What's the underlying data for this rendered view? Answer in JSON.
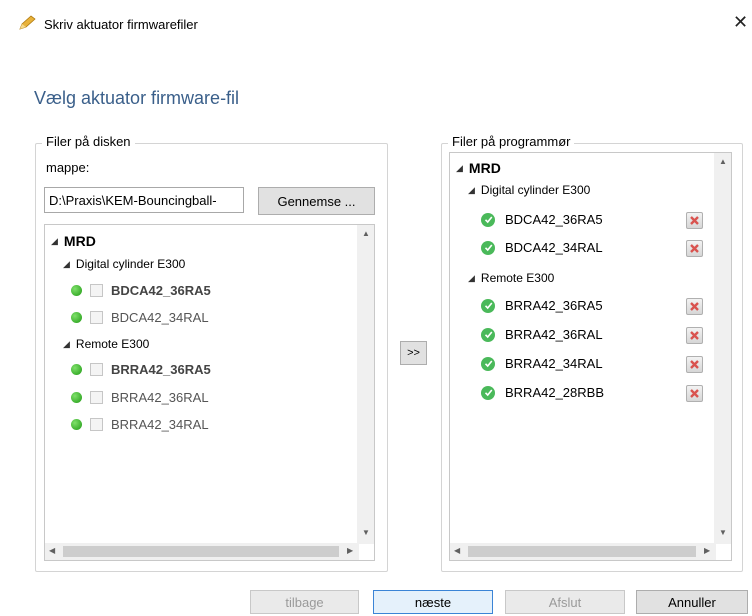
{
  "window": {
    "title": "Skriv aktuator firmwarefiler",
    "app_icon": "pencil-icon",
    "close_icon": "close-icon"
  },
  "heading": "Vælg aktuator firmware-fil",
  "disk_panel": {
    "title": "Filer på disken",
    "folder_label": "mappe:",
    "path_value": "D:\\Praxis\\KEM-Bouncingball-",
    "browse_label": "Gennemse ...",
    "tree": {
      "root": "MRD",
      "groups": [
        {
          "label": "Digital cylinder E300",
          "items": [
            {
              "label": "BDCA42_36RA5",
              "bold": true
            },
            {
              "label": "BDCA42_34RAL",
              "bold": false
            }
          ]
        },
        {
          "label": "Remote E300",
          "items": [
            {
              "label": "BRRA42_36RA5",
              "bold": true
            },
            {
              "label": "BRRA42_36RAL",
              "bold": false
            },
            {
              "label": "BRRA42_34RAL",
              "bold": false
            }
          ]
        }
      ]
    }
  },
  "transfer_label": ">>",
  "programmer_panel": {
    "title": "Filer på programmør",
    "tree": {
      "root": "MRD",
      "groups": [
        {
          "label": "Digital cylinder E300",
          "items": [
            "BDCA42_36RA5",
            "BDCA42_34RAL"
          ]
        },
        {
          "label": "Remote E300",
          "items": [
            "BRRA42_36RA5",
            "BRRA42_36RAL",
            "BRRA42_34RAL",
            "BRRA42_28RBB"
          ]
        }
      ]
    }
  },
  "footer": {
    "back": "tilbage",
    "next": "næste",
    "finish": "Afslut",
    "cancel": "Annuller"
  },
  "colors": {
    "heading": "#3a5f8a",
    "status_green": "#2db11a",
    "check_green": "#4ab95a",
    "delete_red": "#d9534f"
  }
}
